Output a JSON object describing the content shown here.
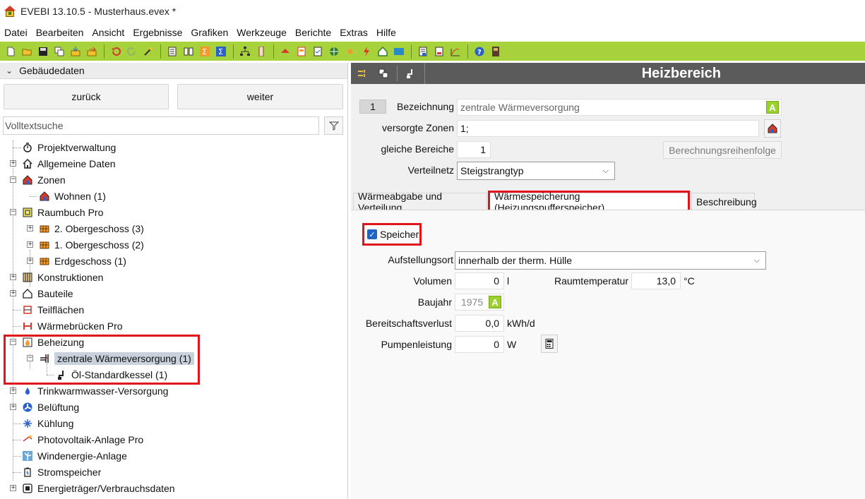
{
  "window": {
    "title": "EVEBI 13.10.5 - Musterhaus.evex *"
  },
  "menu": [
    "Datei",
    "Bearbeiten",
    "Ansicht",
    "Ergebnisse",
    "Grafiken",
    "Werkzeuge",
    "Berichte",
    "Extras",
    "Hilfe"
  ],
  "colors": {
    "toolbar": "#a8d23c",
    "header_dark": "#5b5b5b",
    "highlight": "#e2141b",
    "selection": "#c9d2dc",
    "a_badge": "#9bd12e"
  },
  "left": {
    "header": "Gebäudedaten",
    "back": "zurück",
    "next": "weiter",
    "search_placeholder": "Volltextsuche",
    "tree": {
      "projekt": "Projektverwaltung",
      "allgemein": "Allgemeine Daten",
      "zonen": "Zonen",
      "wohnen": "Wohnen (1)",
      "raumbuch": "Raumbuch Pro",
      "og2": "2. Obergeschoss (3)",
      "og1": "1. Obergeschoss (2)",
      "eg": "Erdgeschoss (1)",
      "konstruktionen": "Konstruktionen",
      "bauteile": "Bauteile",
      "teilflaechen": "Teilflächen",
      "waermebruecken": "Wärmebrücken Pro",
      "beheizung": "Beheizung",
      "zentral": "zentrale Wärmeversorgung (1)",
      "kessel": "Öl-Standardkessel (1)",
      "trinkwasser": "Trinkwarmwasser-Versorgung",
      "belueftung": "Belüftung",
      "kuehlung": "Kühlung",
      "pv": "Photovoltaik-Anlage Pro",
      "wind": "Windenergie-Anlage",
      "stromspeicher": "Stromspeicher",
      "energietraeger": "Energieträger/Verbrauchsdaten"
    }
  },
  "right": {
    "title": "Heizbereich",
    "number": "1",
    "bezeichnung_label": "Bezeichnung",
    "bezeichnung_value": "zentrale Wärmeversorgung",
    "a_badge": "A",
    "zonen_label": "versorgte Zonen",
    "zonen_value": "1;",
    "gleiche_label": "gleiche Bereiche",
    "gleiche_value": "1",
    "reihenfolge_btn": "Berechnungsreihenfolge",
    "verteilnetz_label": "Verteilnetz",
    "verteilnetz_value": "Steigstrangtyp",
    "tabs": [
      "Wärmeabgabe und Verteilung",
      "Wärmespeicherung (Heizungspufferspeicher)",
      "Beschreibung"
    ],
    "speicher": {
      "checkbox_label": "Speicher",
      "checked": true,
      "aufstellungsort_label": "Aufstellungsort",
      "aufstellungsort_value": "innerhalb der therm. Hülle",
      "volumen_label": "Volumen",
      "volumen_value": "0",
      "volumen_unit": "l",
      "raumtemp_label": "Raumtemperatur",
      "raumtemp_value": "13,0",
      "raumtemp_unit": "°C",
      "baujahr_label": "Baujahr",
      "baujahr_value": "1975",
      "bereitschaft_label": "Bereitschaftsverlust",
      "bereitschaft_value": "0,0",
      "bereitschaft_unit": "kWh/d",
      "pumpe_label": "Pumpenleistung",
      "pumpe_value": "0",
      "pumpe_unit": "W"
    }
  }
}
